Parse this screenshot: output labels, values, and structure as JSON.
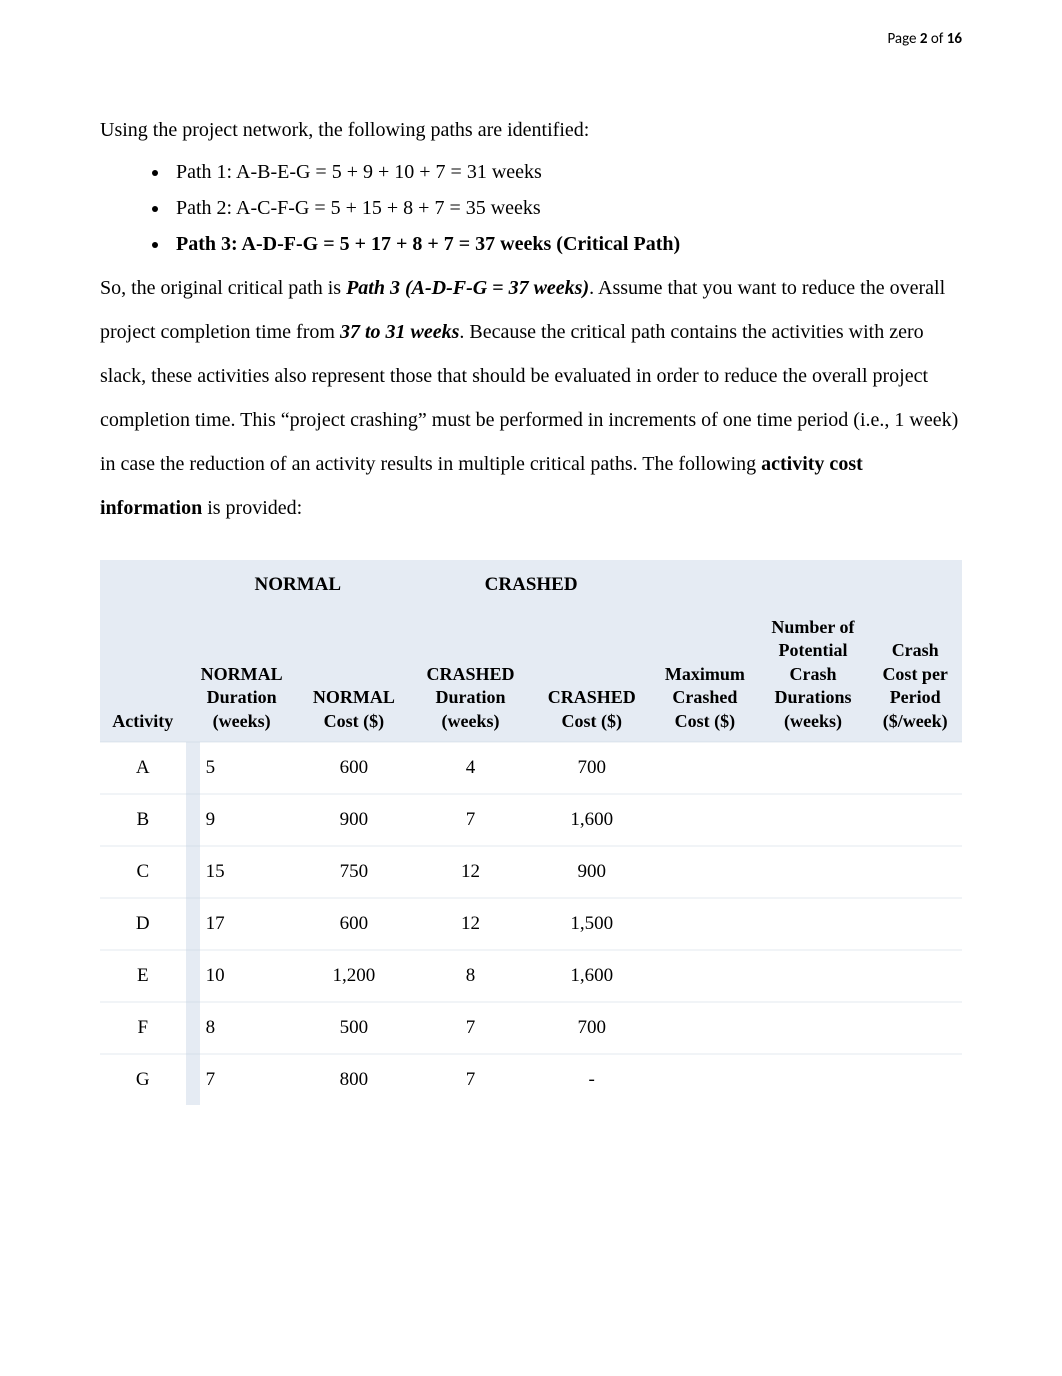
{
  "pageinfo": {
    "prefix": "Page ",
    "current": "2",
    "sep": " of ",
    "total": "16"
  },
  "intro": "Using the project network, the following paths are identified:",
  "paths": {
    "p1": "Path 1: A-B-E-G = 5 + 9 + 10 + 7 = 31 weeks",
    "p2": "Path 2: A-C-F-G = 5 + 15 + 8 + 7 = 35 weeks",
    "p3": "Path 3: A-D-F-G = 5 + 17 + 8 + 7 = 37 weeks (Critical Path)"
  },
  "para": {
    "t1": "So, the original critical path is ",
    "crit": "Path 3 (A-D-F-G = 37 weeks)",
    "t2": ".  Assume that you want to reduce the overall project completion time from ",
    "reduce": "37 to 31 weeks",
    "t3": ".  Because the critical path contains the activities with zero slack, these activities also represent those that should be evaluated in order to reduce the overall project completion time.  This “project crashing” must be performed in increments of one time period (i.e., 1 week) in case the reduction of an activity results in multiple critical paths.  The following ",
    "aci": "activity cost information",
    "t4": " is provided:"
  },
  "table": {
    "group": {
      "normal": "NORMAL",
      "crashed": "CRASHED"
    },
    "headers": {
      "activity": "Activity",
      "ndur": "NORMAL Duration (weeks)",
      "ncost": "NORMAL Cost ($)",
      "cdur": "CRASHED Duration (weeks)",
      "ccost": "CRASHED Cost ($)",
      "maxcc": "Maximum Crashed Cost ($)",
      "npcd": "Number of Potential Crash Durations (weeks)",
      "ccpp": "Crash Cost per Period ($/week)"
    },
    "rows": [
      {
        "activity": "A",
        "ndur": "5",
        "ncost": "600",
        "cdur": "4",
        "ccost": "700",
        "maxcc": "",
        "npcd": "",
        "ccpp": ""
      },
      {
        "activity": "B",
        "ndur": "9",
        "ncost": "900",
        "cdur": "7",
        "ccost": "1,600",
        "maxcc": "",
        "npcd": "",
        "ccpp": ""
      },
      {
        "activity": "C",
        "ndur": "15",
        "ncost": "750",
        "cdur": "12",
        "ccost": "900",
        "maxcc": "",
        "npcd": "",
        "ccpp": ""
      },
      {
        "activity": "D",
        "ndur": "17",
        "ncost": "600",
        "cdur": "12",
        "ccost": "1,500",
        "maxcc": "",
        "npcd": "",
        "ccpp": ""
      },
      {
        "activity": "E",
        "ndur": "10",
        "ncost": "1,200",
        "cdur": "8",
        "ccost": "1,600",
        "maxcc": "",
        "npcd": "",
        "ccpp": ""
      },
      {
        "activity": "F",
        "ndur": "8",
        "ncost": "500",
        "cdur": "7",
        "ccost": "700",
        "maxcc": "",
        "npcd": "",
        "ccpp": ""
      },
      {
        "activity": "G",
        "ndur": "7",
        "ncost": "800",
        "cdur": "7",
        "ccost": "-",
        "maxcc": "",
        "npcd": "",
        "ccpp": ""
      }
    ]
  }
}
